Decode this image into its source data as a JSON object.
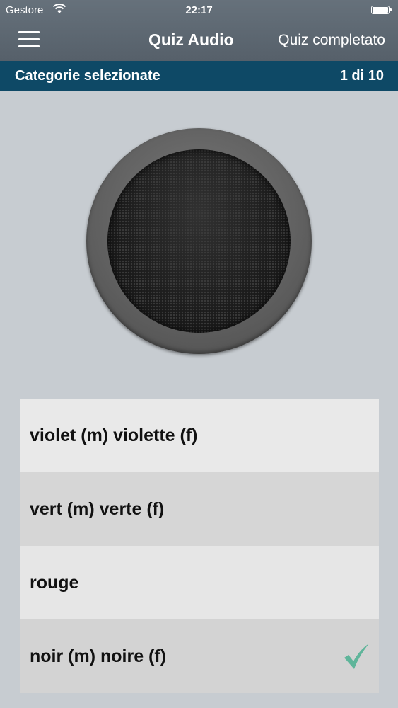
{
  "status_bar": {
    "carrier": "Gestore",
    "time": "22:17"
  },
  "nav": {
    "title": "Quiz Audio",
    "right_action": "Quiz completato",
    "menu_icon": "hamburger-menu-icon"
  },
  "category_bar": {
    "label": "Categorie selezionate",
    "progress": "1 di 10"
  },
  "speaker": {
    "icon": "speaker-grill-icon"
  },
  "answers": [
    {
      "label": "violet (m)  violette (f)",
      "selected": false
    },
    {
      "label": "vert (m)  verte (f)",
      "selected": false
    },
    {
      "label": "rouge",
      "selected": false
    },
    {
      "label": "noir (m)  noire (f)",
      "selected": true
    }
  ],
  "colors": {
    "nav_bg": "#5e6872",
    "category_bar_bg": "#0e4966",
    "page_bg": "#c7ccd1",
    "check": "#5fb59a"
  }
}
